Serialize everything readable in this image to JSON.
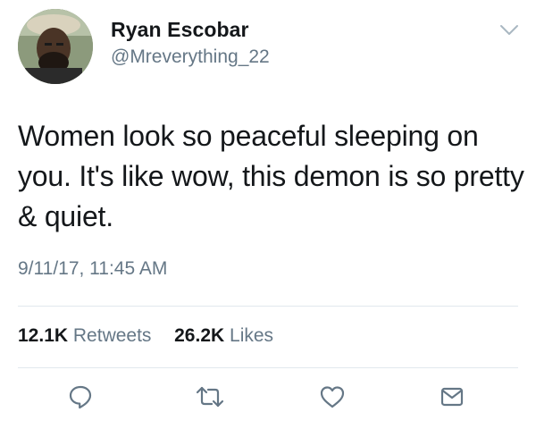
{
  "author": {
    "display_name": "Ryan Escobar",
    "handle": "@Mreverything_22",
    "avatar_icon": "user-avatar-photo"
  },
  "header": {
    "menu_icon": "chevron-down-icon"
  },
  "tweet": {
    "text": "Women look so peaceful sleeping on you. It's like wow, this demon is so pretty & quiet.",
    "timestamp": "9/11/17, 11:45 AM"
  },
  "stats": {
    "retweets_count": "12.1K",
    "retweets_label": "Retweets",
    "likes_count": "26.2K",
    "likes_label": "Likes"
  },
  "actions": [
    {
      "name": "reply",
      "icon": "reply-icon"
    },
    {
      "name": "retweet",
      "icon": "retweet-icon"
    },
    {
      "name": "like",
      "icon": "heart-icon"
    },
    {
      "name": "direct-message",
      "icon": "envelope-icon"
    }
  ],
  "colors": {
    "primary_text": "#14171a",
    "secondary_text": "#657786",
    "divider": "#e1e8ed",
    "background": "#ffffff"
  }
}
